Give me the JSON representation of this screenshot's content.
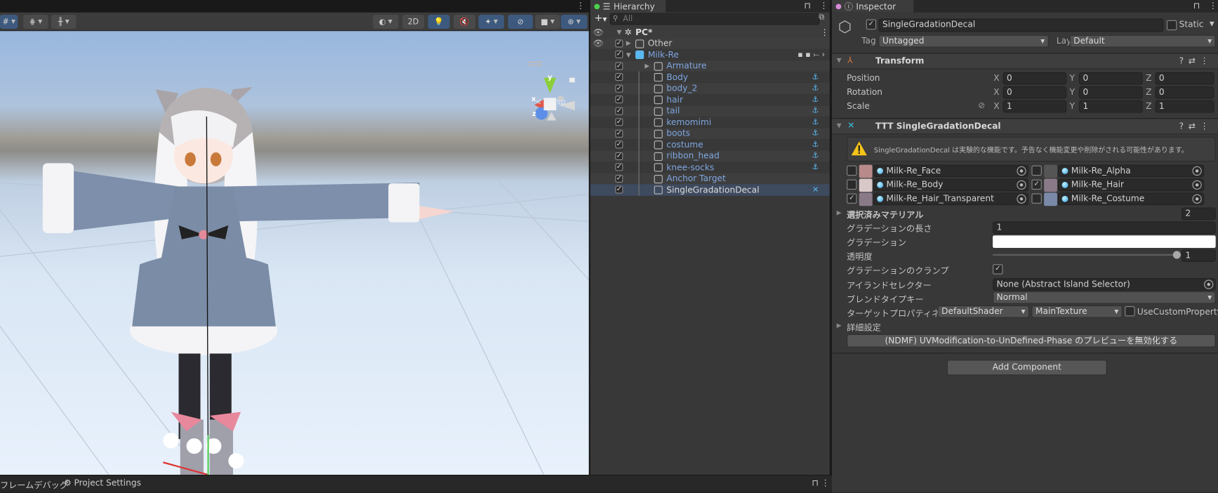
{
  "scene": {
    "toolbar": {
      "mode_2d": "2D",
      "icons": [
        "grid-snap-icon",
        "increment-snap-icon",
        "ruler-icon",
        "shading-mode-icon",
        "lighting-icon",
        "audio-mute-icon",
        "effects-icon",
        "visibility-icon",
        "camera-icon",
        "gizmos-icon"
      ]
    },
    "gizmo": {
      "x": "x",
      "y": "y",
      "z": "z",
      "projection": "Persp"
    }
  },
  "bottom_tabs": [
    "フレームデバッグ",
    "Project Settings"
  ],
  "hierarchy": {
    "title": "Hierarchy",
    "search_placeholder": "All",
    "scene": "PC*",
    "items": [
      {
        "label": "Other",
        "depth": 0,
        "expanded": false,
        "checked": true
      },
      {
        "label": "Milk-Re",
        "depth": 0,
        "expanded": true,
        "checked": true,
        "prefab": true
      },
      {
        "label": "Armature",
        "depth": 1,
        "expanded": false,
        "checked": true
      },
      {
        "label": "Body",
        "depth": 1,
        "checked": true,
        "icon": "anchor-icon"
      },
      {
        "label": "body_2",
        "depth": 1,
        "checked": true,
        "icon": "anchor-icon"
      },
      {
        "label": "hair",
        "depth": 1,
        "checked": true,
        "icon": "anchor-icon"
      },
      {
        "label": "tail",
        "depth": 1,
        "checked": true,
        "icon": "anchor-icon"
      },
      {
        "label": "kemomimi",
        "depth": 1,
        "checked": true,
        "icon": "anchor-icon"
      },
      {
        "label": "boots",
        "depth": 1,
        "checked": true,
        "icon": "anchor-icon"
      },
      {
        "label": "costume",
        "depth": 1,
        "checked": true,
        "icon": "anchor-icon"
      },
      {
        "label": "ribbon_head",
        "depth": 1,
        "checked": true,
        "icon": "anchor-icon"
      },
      {
        "label": "knee-socks",
        "depth": 1,
        "checked": true,
        "icon": "anchor-icon"
      },
      {
        "label": "Anchor Target",
        "depth": 1,
        "checked": true
      },
      {
        "label": "SingleGradationDecal",
        "depth": 1,
        "checked": true,
        "selected": true,
        "icon": "ttt-icon"
      }
    ]
  },
  "inspector": {
    "title": "Inspector",
    "object_name": "SingleGradationDecal",
    "active": true,
    "static_label": "Static",
    "tag_label": "Tag",
    "tag_value": "Untagged",
    "layer_label": "Layer",
    "layer_value": "Default",
    "transform": {
      "title": "Transform",
      "rows": [
        {
          "label": "Position",
          "x": "0",
          "y": "0",
          "z": "0"
        },
        {
          "label": "Rotation",
          "x": "0",
          "y": "0",
          "z": "0"
        },
        {
          "label": "Scale",
          "x": "1",
          "y": "1",
          "z": "1"
        }
      ],
      "axes": [
        "X",
        "Y",
        "Z"
      ]
    },
    "ttt": {
      "title": "TTT SingleGradationDecal",
      "warning": "SingleGradationDecal は実験的な機能です。予告なく機能変更や削除がされる可能性があります。",
      "materials": [
        {
          "name": "Milk-Re_Face",
          "checked": false
        },
        {
          "name": "Milk-Re_Alpha",
          "checked": false
        },
        {
          "name": "Milk-Re_Body",
          "checked": false
        },
        {
          "name": "Milk-Re_Hair",
          "checked": true
        },
        {
          "name": "Milk-Re_Hair_Transparent",
          "checked": true
        },
        {
          "name": "Milk-Re_Costume",
          "checked": false
        }
      ],
      "selected_materials_label": "選択済みマテリアル",
      "selected_materials_count": "2",
      "gradation_length_label": "グラデーションの長さ",
      "gradation_length": "1",
      "gradation_label": "グラデーション",
      "gradation_color": "#ffffff",
      "alpha_label": "透明度",
      "alpha": "1",
      "clamp_label": "グラデーションのクランプ",
      "clamp": true,
      "island_selector_label": "アイランドセレクター",
      "island_selector": "None (Abstract Island Selector)",
      "blend_key_label": "ブレンドタイプキー",
      "blend_key": "Normal",
      "target_property_label": "ターゲットプロパティネーム",
      "target_shader": "DefaultShader",
      "target_property": "MainTexture",
      "use_custom_property_label": "UseCustomProperty",
      "advanced_label": "詳細設定",
      "ndmf_button": "(NDMF) UVModification-to-UnDefined-Phase のプレビューを無効化する"
    },
    "add_component": "Add Component"
  }
}
